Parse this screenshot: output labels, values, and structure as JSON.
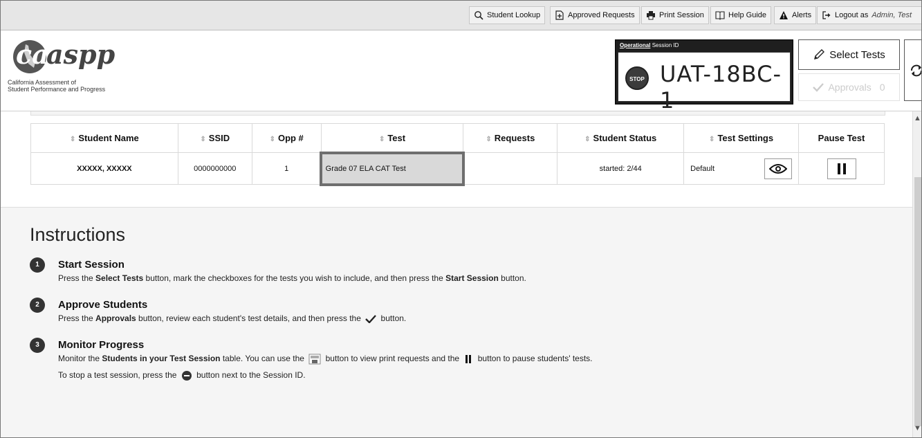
{
  "nav": {
    "student_lookup": "Student Lookup",
    "approved_requests": "Approved Requests",
    "print_session": "Print Session",
    "help_guide": "Help Guide",
    "alerts": "Alerts",
    "logout_as": "Logout as",
    "user": "Admin, Test"
  },
  "header": {
    "logo_text": "caaspp",
    "logo_sub_line1": "California Assessment of",
    "logo_sub_line2": "Student Performance and Progress",
    "session_label_bold": "Operational",
    "session_label_rest": "Session ID",
    "stop_label": "STOP",
    "session_id": "UAT-18BC-1",
    "select_tests": "Select Tests",
    "approvals": "Approvals",
    "approvals_count": "0"
  },
  "table": {
    "columns": [
      "Student Name",
      "SSID",
      "Opp #",
      "Test",
      "Requests",
      "Student Status",
      "Test Settings",
      "Pause Test"
    ],
    "rows": [
      {
        "name": "XXXXX, XXXXX",
        "ssid": "0000000000",
        "opp": "1",
        "test": "Grade 07 ELA CAT Test",
        "requests": "",
        "status": "started: 2/44",
        "settings": "Default"
      }
    ]
  },
  "instructions": {
    "title": "Instructions",
    "steps": [
      {
        "num": "1",
        "title": "Start Session",
        "t1": "Press the ",
        "b1": "Select Tests",
        "t2": " button, mark the checkboxes for the tests you wish to include, and then press the ",
        "b2": "Start Session",
        "t3": " button."
      },
      {
        "num": "2",
        "title": "Approve Students",
        "t1": "Press the ",
        "b1": "Approvals",
        "t2": " button, review each student's test details, and then press the ",
        "t3": " button."
      },
      {
        "num": "3",
        "title": "Monitor Progress",
        "t1": "Monitor the ",
        "b1": "Students in your Test Session",
        "t2": " table. You can use the ",
        "t3": " button to view print requests and the ",
        "t4": " button to pause students' tests.",
        "line2_a": "To stop a test session, press the ",
        "line2_b": " button next to the Session ID."
      }
    ]
  }
}
